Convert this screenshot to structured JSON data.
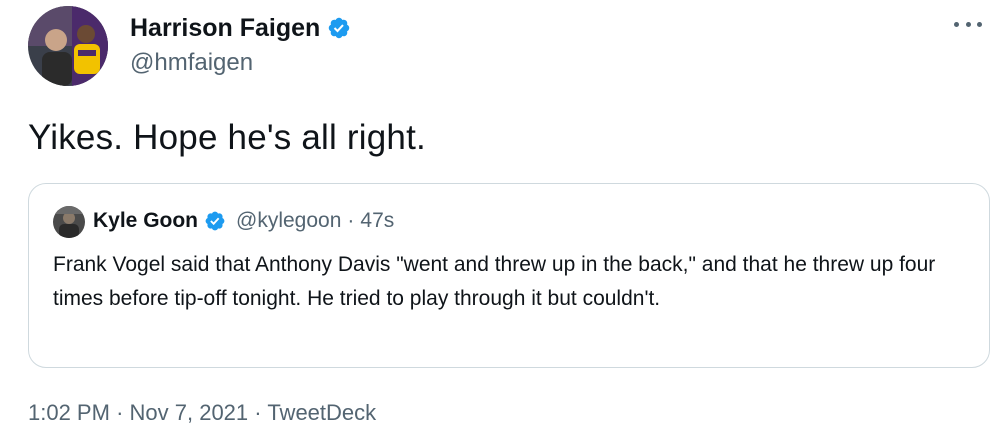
{
  "author": {
    "display_name": "Harrison Faigen",
    "handle": "@hmfaigen",
    "verified_color": "#1d9bf0",
    "avatar_icon": "profile-photo-avatar"
  },
  "more_icon": "more-options-icon",
  "tweet_text": "Yikes. Hope he's all right.",
  "quoted_tweet": {
    "display_name": "Kyle Goon",
    "handle": "@kylegoon",
    "separator": "·",
    "time": "47s",
    "text": "Frank Vogel said that Anthony Davis \"went and threw up in the back,\" and that he threw up four times before tip-off tonight. He tried to play through it but couldn't."
  },
  "footer": {
    "time": "1:02 PM",
    "sep1": "·",
    "date": "Nov 7, 2021",
    "sep2": "·",
    "source": "TweetDeck"
  },
  "colors": {
    "text_primary": "#0f1419",
    "text_secondary": "#536471",
    "border": "#cfd9de",
    "verified_blue": "#1d9bf0"
  }
}
